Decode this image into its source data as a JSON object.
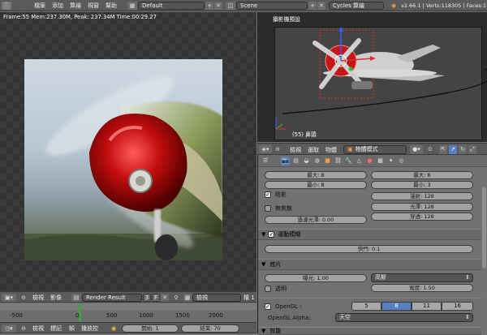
{
  "top_header": {
    "menus": [
      "檔案",
      "添加",
      "算繪",
      "視窗",
      "幫助"
    ],
    "screen_layout": "Default",
    "scene": "Scene",
    "engine": "Cycles 算繪",
    "stats": "v2.66.1 | Verts:118305 | Faces:11"
  },
  "image_editor": {
    "info_line": "Frame:55 Mem:237.30M, Peak: 237.34M Time:00:29.27",
    "header": {
      "menus": [
        "檢視",
        "影像"
      ],
      "image_name": "Render Result",
      "slot": "3",
      "fake_user": "F",
      "view_mode": "檢視",
      "layer_partial": "檜 1"
    }
  },
  "viewport": {
    "title": "攝影機預設",
    "object_label": "(55) 鼻頭"
  },
  "timeline": {
    "ticks": [
      "-500",
      "0",
      "500",
      "1000",
      "1500",
      "2000"
    ],
    "menus": [
      "檢視",
      "標記",
      "幀",
      "播放控"
    ],
    "start": "開始: 1",
    "end": "結束: 70"
  },
  "properties": {
    "header": {
      "menus": [
        "檢視",
        "選取",
        "物體"
      ],
      "mode": "物體模式"
    },
    "bounces_left": [
      "最大: 8",
      "最小: 8"
    ],
    "bounces_right": [
      "最大: 8",
      "最小: 3",
      "漫射: 128",
      "光澤: 128",
      "穿透: 128"
    ],
    "shadows_label": "陰影",
    "no_caustics_label": "無焦散",
    "filter_glossy": "過濾光澤: 0.00",
    "motion_blur": {
      "title": "運動模糊",
      "shutter": "快門: 0.1"
    },
    "film": {
      "title": "底片",
      "exposure": "曝光: 1.00",
      "filter_type": "高斯",
      "width": "寬度: 1.50",
      "transparent_label": "透明"
    },
    "opengl": {
      "label": "OpenGL :",
      "samples": [
        "5",
        "8",
        "11",
        "16"
      ],
      "selected": "8",
      "alpha_label": "OpenGL Alpha:",
      "alpha_value": "天空"
    },
    "performance_title": "效能"
  },
  "colors": {
    "accent_blue": "#5680c2",
    "timeline_playhead": "#3fa13f",
    "header_gray": "#5a5a5a"
  }
}
